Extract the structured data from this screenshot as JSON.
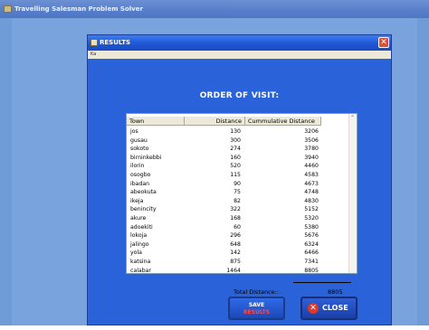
{
  "app": {
    "title": "Travelling Salesman Problem Solver"
  },
  "dialog": {
    "title": "RESULTS",
    "menu_text": "Ka",
    "close_glyph": "✕",
    "heading": "ORDER OF VISIT:"
  },
  "table": {
    "headers": [
      "Town",
      "Distance",
      "Cummulative Distance"
    ],
    "rows": [
      {
        "town": "jos",
        "distance": "130",
        "cumulative": "3206"
      },
      {
        "town": "gusau",
        "distance": "300",
        "cumulative": "3506"
      },
      {
        "town": "sokoto",
        "distance": "274",
        "cumulative": "3780"
      },
      {
        "town": "birninkebbi",
        "distance": "160",
        "cumulative": "3940"
      },
      {
        "town": "ilorin",
        "distance": "520",
        "cumulative": "4460"
      },
      {
        "town": "osogbo",
        "distance": "115",
        "cumulative": "4583"
      },
      {
        "town": "ibadan",
        "distance": "90",
        "cumulative": "4673"
      },
      {
        "town": "abeokuta",
        "distance": "75",
        "cumulative": "4748"
      },
      {
        "town": "ikeja",
        "distance": "82",
        "cumulative": "4830"
      },
      {
        "town": "benincity",
        "distance": "322",
        "cumulative": "5152"
      },
      {
        "town": "akure",
        "distance": "168",
        "cumulative": "5320"
      },
      {
        "town": "adoekiti",
        "distance": "60",
        "cumulative": "5380"
      },
      {
        "town": "lokoja",
        "distance": "296",
        "cumulative": "5676"
      },
      {
        "town": "jalingo",
        "distance": "648",
        "cumulative": "6324"
      },
      {
        "town": "yola",
        "distance": "142",
        "cumulative": "6466"
      },
      {
        "town": "katsina",
        "distance": "875",
        "cumulative": "7341"
      },
      {
        "town": "calabar",
        "distance": "1464",
        "cumulative": "8805"
      }
    ],
    "total_label": "Total Distance::",
    "total_value": "8805",
    "scroll_up_glyph": "⌃"
  },
  "buttons": {
    "save_line1": "SAVE",
    "save_line2": "RESULTS",
    "close_icon_glyph": "✕",
    "close_label": "CLOSE"
  },
  "colors": {
    "desktop": "#6f9bd7",
    "dialog_bg": "#2a62d9",
    "save_accent": "#ff4a4a",
    "close_icon": "#d93a2a"
  }
}
